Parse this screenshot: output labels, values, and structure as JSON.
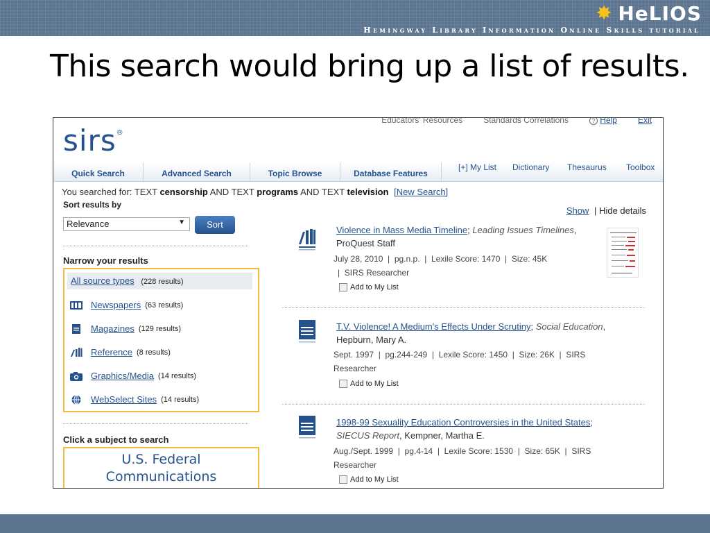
{
  "banner": {
    "logo": "HeLIOS",
    "tagline": "Hemingway Library Information Online Skills tutorial"
  },
  "slide": {
    "title": "This search would bring up a list of results."
  },
  "sirs": {
    "logo": "sirs",
    "logo_mark": "®",
    "top_links": [
      "Educators' Resources",
      "Standards Correlations",
      "Help",
      "Exit"
    ],
    "help_icon": "help-circle-icon",
    "tabs": [
      "Quick Search",
      "Advanced Search",
      "Topic Browse",
      "Database Features"
    ],
    "right_links": [
      "[+] My List",
      "Dictionary",
      "Thesaurus",
      "Toolbox"
    ],
    "searched": {
      "prefix": "You searched for:",
      "t1": "TEXT",
      "k1": "censorship",
      "op1": "AND",
      "t2": "TEXT",
      "k2": "programs",
      "op2": "AND",
      "t3": "TEXT",
      "k3": "television",
      "new_search": "[New Search]"
    },
    "sort": {
      "label": "Sort results by",
      "value": "Relevance",
      "button": "Sort"
    },
    "narrow": {
      "title": "Narrow your results",
      "all": {
        "label": "All source types",
        "count": "(228 results)"
      },
      "items": [
        {
          "label": "Newspapers",
          "count": "(63 results)",
          "icon": "newspaper-icon"
        },
        {
          "label": "Magazines",
          "count": "(129 results)",
          "icon": "magazine-icon"
        },
        {
          "label": "Reference",
          "count": "(8 results)",
          "icon": "reference-icon"
        },
        {
          "label": "Graphics/Media",
          "count": "(14 results)",
          "icon": "camera-icon"
        },
        {
          "label": "WebSelect Sites",
          "count": "(14 results)",
          "icon": "globe-icon"
        }
      ]
    },
    "subject": {
      "title": "Click a subject to search",
      "line1": "U.S. Federal",
      "line2": "Communications"
    },
    "details": {
      "show": "Show",
      "sep": "|",
      "hide": "Hide details"
    },
    "results": [
      {
        "title": "Violence in Mass Media Timeline",
        "source": "Leading Issues Timelines",
        "source_tail": ",",
        "author": "ProQuest Staff",
        "meta_line1": "July 28, 2010  |  pg.n.p.  |  Lexile Score: 1470  |  Size: 45K",
        "meta_line2": "|  SIRS Researcher",
        "add": "Add to My List"
      },
      {
        "title": "T.V. Violence! A Medium's Effects Under Scrutiny",
        "source": "Social Education",
        "source_tail": ",",
        "author": "Hepburn, Mary A.",
        "meta_line1": "Sept. 1997  |  pg.244-249  |  Lexile Score: 1450  |  Size: 26K  |  SIRS",
        "meta_line2": "Researcher",
        "add": "Add to My List"
      },
      {
        "title": "1998-99 Sexuality Education Controversies in the United States",
        "source": "SIECUS Report",
        "source_tail": ", Kempner, Martha E.",
        "author": "",
        "meta_line1": "Aug./Sept. 1999  |  pg.4-14  |  Lexile Score: 1530  |  Size: 65K  |  SIRS",
        "meta_line2": "Researcher",
        "add": "Add to My List"
      }
    ]
  },
  "colors": {
    "banner": "#5d7590",
    "link": "#24528e",
    "highlight_border": "#f5b942"
  }
}
